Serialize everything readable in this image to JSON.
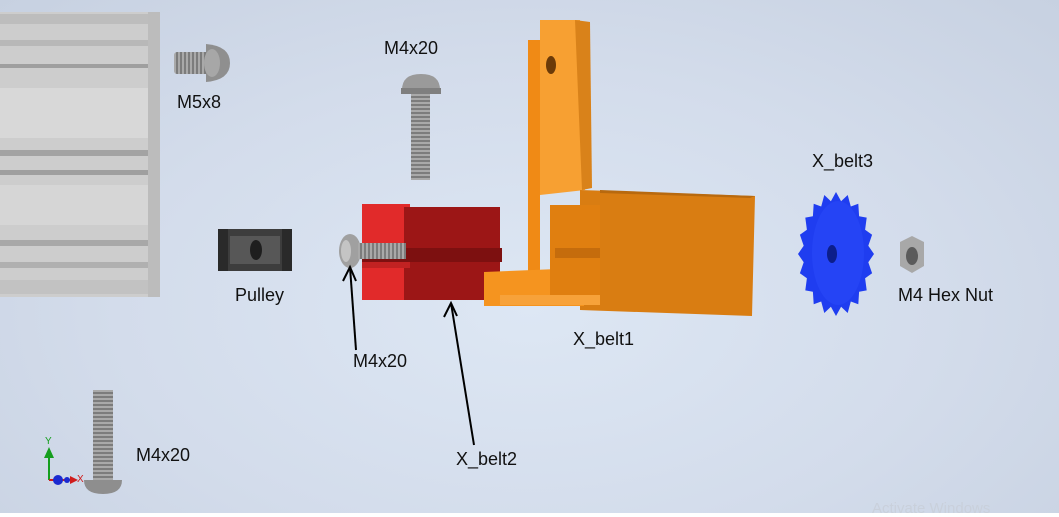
{
  "labels": {
    "m5x8": "M5x8",
    "m4x20_top": "M4x20",
    "x_belt3": "X_belt3",
    "pulley": "Pulley",
    "m4_hex_nut": "M4 Hex Nut",
    "x_belt1": "X_belt1",
    "m4x20_mid": "M4x20",
    "m4x20_bottom": "M4x20",
    "x_belt2": "X_belt2"
  },
  "triad": {
    "y": "Y",
    "x": "X"
  },
  "watermark": "Activate Windows",
  "colors": {
    "background": "#d8e1ef",
    "x_belt1": "#f5941f",
    "x_belt2": "#b01a1a",
    "x_belt3": "#1f3df0",
    "pulley": "#3b3b3b",
    "fastener": "#9a9a9a",
    "extrusion": "#cfcfcf"
  }
}
